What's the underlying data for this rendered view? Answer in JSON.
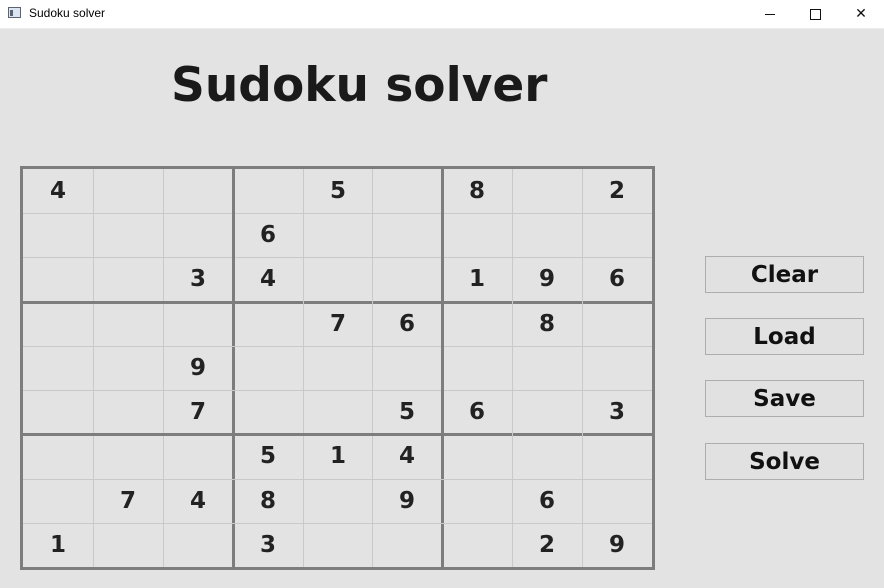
{
  "window": {
    "title": "Sudoku solver",
    "controls": [
      "minimize",
      "maximize",
      "close"
    ]
  },
  "heading": "Sudoku solver",
  "grid": [
    [
      "4",
      "",
      "",
      "",
      "5",
      "",
      "8",
      "",
      "2"
    ],
    [
      "",
      "",
      "",
      "6",
      "",
      "",
      "",
      "",
      ""
    ],
    [
      "",
      "",
      "3",
      "4",
      "",
      "",
      "1",
      "9",
      "6"
    ],
    [
      "",
      "",
      "",
      "",
      "7",
      "6",
      "",
      "8",
      ""
    ],
    [
      "",
      "",
      "9",
      "",
      "",
      "",
      "",
      "",
      ""
    ],
    [
      "",
      "",
      "7",
      "",
      "",
      "5",
      "6",
      "",
      "3"
    ],
    [
      "",
      "",
      "",
      "5",
      "1",
      "4",
      "",
      "",
      ""
    ],
    [
      "",
      "7",
      "4",
      "8",
      "",
      "9",
      "",
      "6",
      ""
    ],
    [
      "1",
      "",
      "",
      "3",
      "",
      "",
      "",
      "2",
      "9"
    ]
  ],
  "buttons": {
    "clear": "Clear",
    "load": "Load",
    "save": "Save",
    "solve": "Solve"
  },
  "colors": {
    "background": "#e3e3e3",
    "thick_grid": "#7d7d7d",
    "thin_grid": "#c9c9c9",
    "digit": "#222222"
  }
}
